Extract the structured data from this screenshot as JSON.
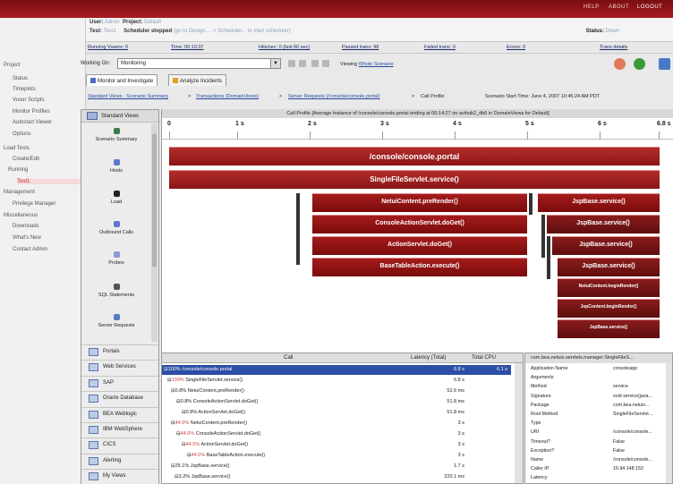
{
  "topbar": {
    "help": "HELP",
    "about": "ABOUT",
    "logout": "LOGOUT"
  },
  "header": {
    "user_label": "User:",
    "user": "Admin",
    "project_label": "Project:",
    "project": "Default",
    "test_label": "Test:",
    "test": "Test1",
    "scheduler": "Scheduler stopped",
    "scheduler_hint": "(go to Design... -> Scheduler... to start scheduler)",
    "status_label": "Status:",
    "status": "Down"
  },
  "stats": [
    "Running Vusers: 0",
    "Time: 00:10:37",
    "Hits/sec: 0 (last 60 sec)",
    "Passed trans: 98",
    "Failed trans: 0",
    "Errors: 0",
    "Trans details"
  ],
  "nav": [
    {
      "label": "Project",
      "indent": 0
    },
    {
      "label": "Status",
      "indent": 2
    },
    {
      "label": "Timeplots",
      "indent": 2
    },
    {
      "label": "Vuser Scripts",
      "indent": 2
    },
    {
      "label": "Monitor Profiles",
      "indent": 2
    },
    {
      "label": "Autostart Viewer",
      "indent": 2
    },
    {
      "label": "Options",
      "indent": 2
    },
    {
      "label": "Load Tests",
      "indent": 0
    },
    {
      "label": "Create/Edit",
      "indent": 2
    },
    {
      "label": "Running",
      "indent": 1
    },
    {
      "label": "Test1",
      "indent": 3
    },
    {
      "label": "Management",
      "indent": 0
    },
    {
      "label": "Privilege Manager",
      "indent": 2
    },
    {
      "label": "Miscellaneous",
      "indent": 0
    },
    {
      "label": "Downloads",
      "indent": 2
    },
    {
      "label": "What's New",
      "indent": 2
    },
    {
      "label": "Contact Admin",
      "indent": 2
    }
  ],
  "toolbar": {
    "working_on": "Working On:",
    "selected": "Monitoring",
    "viewing_label": "Viewing",
    "viewing_value": "Whole Scenario"
  },
  "tabs": [
    "Monitor and Investigate",
    "Analyze Incidents"
  ],
  "breadcrumb": {
    "items": [
      "Standard Views - Scenario Summary",
      "Transactions (DomainViews)",
      "Server Requests (/console/console.portal)",
      "Call Profile"
    ],
    "sep": ">",
    "start_time": "Scenario Start Time:  June 4, 2007 10:45:24 AM PDT"
  },
  "views_panel": {
    "title": "Standard Views",
    "icons": [
      "Scenario Summary",
      "Hosts",
      "Load",
      "Outbound Calls",
      "Probes",
      "SQL Statements",
      "Server Requests"
    ],
    "list": [
      "Portals",
      "Web Services",
      "SAP",
      "Oracle Database",
      "BEA Weblogic",
      "IBM WebSphere",
      "CICS",
      "Alerting",
      "My Views"
    ]
  },
  "profile": {
    "title": "Call Profile [Average Instance of /console/console.portal ending at 00:14:27 on avihub2_db6 in DomainViews for Default]",
    "ticks": [
      "0",
      "1 s",
      "2 s",
      "3 s",
      "4 s",
      "5 s",
      "6 s",
      "6.8 s"
    ],
    "bars": [
      "/console/console.portal",
      "SingleFileServlet.service()",
      "NetuiContent.preRender()",
      "ConsoleActionServlet.doGet()",
      "ActionServlet.doGet()",
      "BaseTableAction.execute()",
      "JspBase.service()",
      "JspBase.service()",
      "JspBase.service()",
      "JspBase.service()",
      "NetuiContent.beginRender()",
      "JspContent.beginRender()",
      "JspBase.service()"
    ]
  },
  "calltable": {
    "columns": [
      "Call",
      "Latency (Total)",
      "Total CPU"
    ],
    "rows": [
      {
        "pct": "100%",
        "name": "/console/console.portal",
        "lat": "6.8 s",
        "cpu": "6.1 s"
      },
      {
        "pct": "100%",
        "name": "SingleFileServlet.service()",
        "lat": "6.8 s",
        "cpu": ""
      },
      {
        "pct": "0.8%",
        "name": "NetuiContent.preRender()",
        "lat": "52.6 ms",
        "cpu": ""
      },
      {
        "pct": "0.8%",
        "name": "ConsoleActionServlet.doGet()",
        "lat": "51.8 ms",
        "cpu": ""
      },
      {
        "pct": "0.8%",
        "name": "ActionServlet.doGet()",
        "lat": "51.8 ms",
        "cpu": ""
      },
      {
        "pct": "44.0%",
        "name": "NetuiContent.preRender()",
        "lat": "3 s",
        "cpu": ""
      },
      {
        "pct": "44.0%",
        "name": "ConsoleActionServlet.doGet()",
        "lat": "3 s",
        "cpu": ""
      },
      {
        "pct": "44.0%",
        "name": "ActionServlet.doGet()",
        "lat": "3 s",
        "cpu": ""
      },
      {
        "pct": "44.0%",
        "name": "BaseTableAction.execute()",
        "lat": "3 s",
        "cpu": ""
      },
      {
        "pct": "25.1%",
        "name": "JspBase.service()",
        "lat": "1.7 s",
        "cpu": ""
      },
      {
        "pct": "3.2%",
        "name": "JspBase.service()",
        "lat": "220.1 ms",
        "cpu": ""
      }
    ]
  },
  "props": {
    "title": "com.bea.netuix.servlets.manager.SingleFileS...",
    "rows": [
      {
        "k": "Application Name",
        "v": "consoleapp"
      },
      {
        "k": "Arguments",
        "v": ""
      },
      {
        "k": "Method",
        "v": "service"
      },
      {
        "k": "Signature",
        "v": "void service(java..."
      },
      {
        "k": "Package",
        "v": "com.bea.netuix..."
      },
      {
        "k": "Root Method",
        "v": "SingleFileServlet..."
      },
      {
        "k": "Type",
        "v": ""
      },
      {
        "k": "URI",
        "v": "/console/console..."
      },
      {
        "k": "Timeout?",
        "v": "False"
      },
      {
        "k": "Exception?",
        "v": "False"
      },
      {
        "k": "Name",
        "v": "/console/console..."
      },
      {
        "k": "Caller IP",
        "v": "16.94.148.153"
      },
      {
        "k": "Latency",
        "v": ""
      }
    ]
  }
}
